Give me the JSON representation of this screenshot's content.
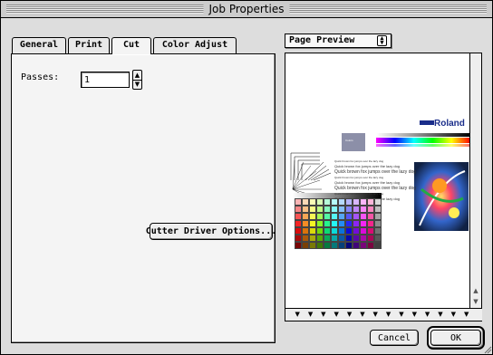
{
  "window": {
    "title": "Job Properties"
  },
  "tabs": [
    {
      "label": "General",
      "active": false
    },
    {
      "label": "Print",
      "active": false
    },
    {
      "label": "Cut",
      "active": true
    },
    {
      "label": "Color Adjust",
      "active": false
    }
  ],
  "cut_panel": {
    "passes_label": "Passes:",
    "passes_value": "1",
    "cutter_button_label": "Cutter Driver Options..."
  },
  "preview": {
    "dropdown_label": "Page Preview",
    "page": {
      "logo_text": "Roland",
      "colors_label": "Colors",
      "sample_lines": [
        "Quick brown fox jumps over the lazy dog",
        "Quick brown fox jumps over the lazy dog",
        "Quick brown fox jumps over the lazy dog",
        "Quick brown fox jumps over the lazy dog",
        "Quick brown fox jumps over the lazy dog",
        "Quick brown fox jumps over the lazy dog",
        "Quick brown fox jumps over the lazy dog",
        "Quick brown fox jumps over the lazy dog"
      ]
    }
  },
  "buttons": {
    "cancel": "Cancel",
    "ok": "OK"
  },
  "icons": {
    "stepper_up": "stepper-up-icon",
    "stepper_down": "stepper-down-icon",
    "dropdown_arrows": "updown-arrows-icon",
    "scroll_up": "scroll-up-arrow-icon",
    "scroll_down": "scroll-down-arrow-icon",
    "scroll_right": "scroll-marker-icon"
  },
  "colors": {
    "chrome": "#dddddd",
    "panel": "#f4f4f4",
    "logo": "#1a2d8a"
  }
}
